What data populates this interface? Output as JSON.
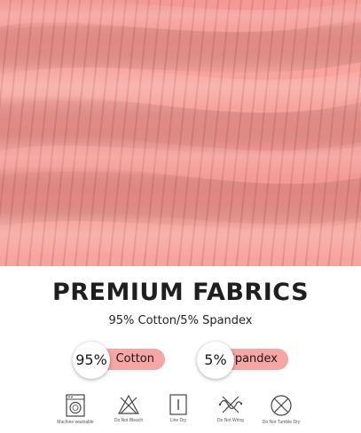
{
  "heading": {
    "title": "PREMIUM FABRICS",
    "subtitle": "95% Cotton/5% Spandex"
  },
  "composition": [
    {
      "percent": "95%",
      "material": "Cotton"
    },
    {
      "percent": "5%",
      "material": "Spandex"
    }
  ],
  "care_instructions": [
    {
      "icon": "machine-washable-icon",
      "label": "Machine washable"
    },
    {
      "icon": "do-not-bleach-icon",
      "label": "Do Not Bleach"
    },
    {
      "icon": "line-dry-icon",
      "label": "Line Dry"
    },
    {
      "icon": "do-not-wring-icon",
      "label": "Do Not Wring"
    },
    {
      "icon": "do-not-tumble-dry-icon",
      "label": "Do Not Tumble Dry"
    }
  ],
  "colors": {
    "fabric": "#f39a95",
    "accent_pill": "#f6a6a5",
    "title_text": "#1f1f1f"
  }
}
